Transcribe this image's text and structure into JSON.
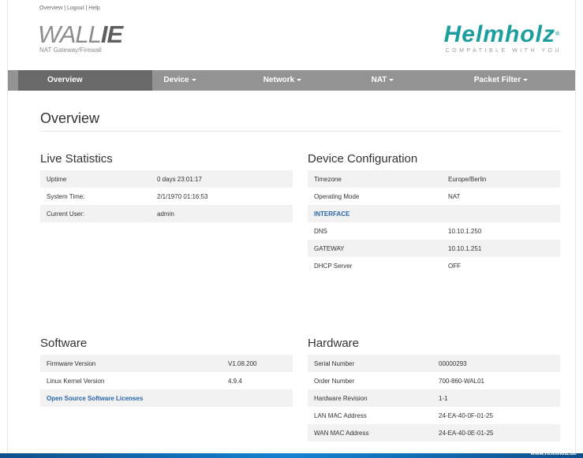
{
  "top_links": {
    "overview": "Overview",
    "logout": "Logout",
    "help": "Help",
    "separator": "|"
  },
  "logo_left": {
    "wall": "WALL",
    "ie": "IE",
    "subtitle": "NAT Gateway/Firewall"
  },
  "logo_right": {
    "name": "Helmholz",
    "reg": "®",
    "tagline": "COMPATIBLE WITH YOU"
  },
  "nav": {
    "items": [
      {
        "label": "Overview",
        "active": true,
        "dropdown": false
      },
      {
        "label": "Device",
        "active": false,
        "dropdown": true
      },
      {
        "label": "Network",
        "active": false,
        "dropdown": true
      },
      {
        "label": "NAT",
        "active": false,
        "dropdown": true
      },
      {
        "label": "Packet Filter",
        "active": false,
        "dropdown": true
      }
    ]
  },
  "page": {
    "title": "Overview"
  },
  "live_statistics": {
    "title": "Live Statistics",
    "rows": [
      {
        "key": "Uptime",
        "value": "0 days 23:01:17"
      },
      {
        "key": "System Time:",
        "value": "2/1/1970 01:16:53"
      },
      {
        "key": "Current User:",
        "value": "admin"
      }
    ]
  },
  "device_configuration": {
    "title": "Device Configuration",
    "rows": [
      {
        "key": "Timezone",
        "value": "Europe/Berlin"
      },
      {
        "key": "Operating Mode",
        "value": "NAT"
      },
      {
        "key": "INTERFACE",
        "value": ""
      },
      {
        "key": "DNS",
        "value": "10.10.1.250"
      },
      {
        "key": "GATEWAY",
        "value": "10.10.1.251"
      },
      {
        "key": "DHCP Server",
        "value": "OFF"
      }
    ]
  },
  "software": {
    "title": "Software",
    "rows": [
      {
        "key": "Firmware Version",
        "value": "V1.08.200"
      },
      {
        "key": "Linux Kernel Version",
        "value": "4.9.4"
      }
    ],
    "license_link": "Open Source Software Licenses"
  },
  "hardware": {
    "title": "Hardware",
    "rows": [
      {
        "key": "Serial Number",
        "value": "00000293"
      },
      {
        "key": "Order Number",
        "value": "700-860-WAL01"
      },
      {
        "key": "Hardware Revision",
        "value": "1-1"
      },
      {
        "key": "LAN MAC Address",
        "value": "24-EA-40-0F-01-25"
      },
      {
        "key": "WAN MAC Address",
        "value": "24-EA-40-0E-01-25"
      }
    ]
  },
  "footer": {
    "link": "www.helmholz.de"
  },
  "colors": {
    "nav_bg": "#939393",
    "nav_active": "#696969",
    "brand": "#1d9e9e",
    "link": "#2a66a8",
    "footer": "#1583d1"
  }
}
